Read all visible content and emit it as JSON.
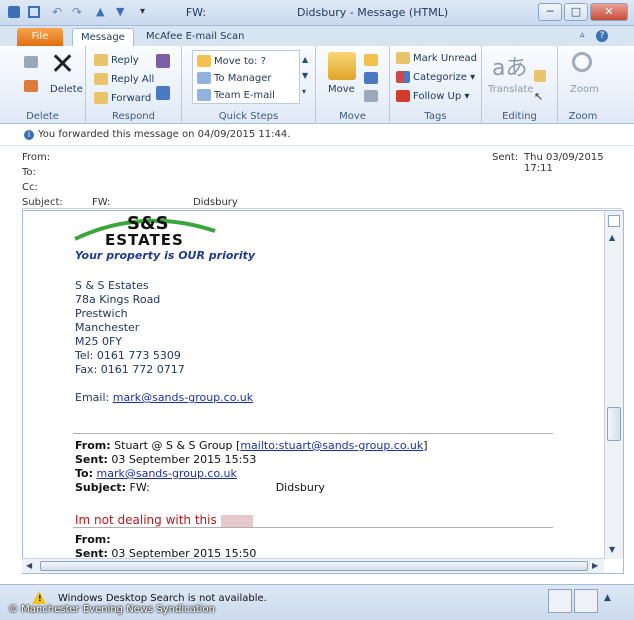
{
  "window": {
    "title": "FW:                          Didsbury - Message (HTML)",
    "minimize": "─",
    "restore": "□",
    "close": "✕"
  },
  "tabs": {
    "file": "File",
    "message": "Message",
    "mcafee": "McAfee E-mail Scan"
  },
  "ribbon": {
    "delete_group": {
      "delete": "Delete",
      "label": "Delete"
    },
    "respond_group": {
      "reply": "Reply",
      "reply_all": "Reply All",
      "forward": "Forward",
      "label": "Respond"
    },
    "quick_steps": {
      "move_to": "Move to: ?",
      "to_manager": "To Manager",
      "team_email": "Team E-mail",
      "label": "Quick Steps"
    },
    "move_group": {
      "move": "Move",
      "label": "Move"
    },
    "tags_group": {
      "mark_unread": "Mark Unread",
      "categorize": "Categorize",
      "follow_up": "Follow Up",
      "label": "Tags"
    },
    "editing_group": {
      "translate": "Translate",
      "label": "Editing"
    },
    "zoom_group": {
      "zoom": "Zoom",
      "label": "Zoom"
    }
  },
  "header": {
    "forward_info": "You forwarded this message on 04/09/2015 11:44.",
    "from_label": "From:",
    "to_label": "To:",
    "cc_label": "Cc:",
    "subject_label": "Subject:",
    "subject_value": "FW:                          Didsbury",
    "sent_label": "Sent:",
    "sent_value": "Thu 03/09/2015 17:11"
  },
  "body": {
    "logo_text": "S&S\nESTATES",
    "logo_line1": "S&S",
    "logo_line2": "ESTATES",
    "tagline": "Your property is OUR priority",
    "address": [
      "S & S Estates",
      "78a Kings Road",
      "Prestwich",
      "Manchester",
      "M25 0FY",
      "Tel: 0161 773 5309",
      "Fax: 0161 772 0717"
    ],
    "email_label": "Email:",
    "email_link": "mark@sands-group.co.uk",
    "fw1": {
      "from_label": "From:",
      "from_value": "Stuart @ S & S Group [",
      "from_link": "mailto:stuart@sands-group.co.uk",
      "from_close": "]",
      "sent_label": "Sent:",
      "sent_value": "03 September 2015 15:53",
      "to_label": "To:",
      "to_link": "mark@sands-group.co.uk",
      "subject_label": "Subject:",
      "subject_value": "FW:                                    Didsbury"
    },
    "red_message": "Im not dealing with this",
    "fw2": {
      "from_label": "From:",
      "sent_label": "Sent:",
      "sent_value": "03 September 2015 15:50"
    }
  },
  "status": {
    "text": "Windows Desktop Search is not available."
  },
  "watermark": "© Manchester Evening News Syndication",
  "colors": {
    "file_tab": "#e26e12",
    "red_text": "#c0141e",
    "link": "#1a2fb5",
    "tagline": "#1f3a93",
    "logo_green": "#3aa63c"
  }
}
